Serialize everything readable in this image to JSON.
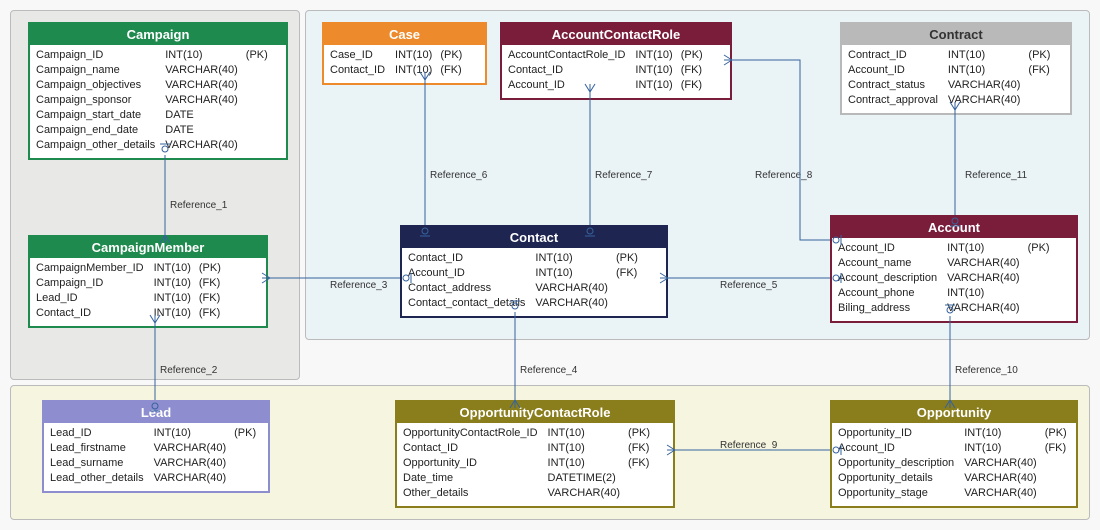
{
  "diagram_type": "ER diagram",
  "entities": {
    "campaign": {
      "title": "Campaign",
      "fields": [
        {
          "name": "Campaign_ID",
          "type": "INT(10)",
          "key": "(PK)"
        },
        {
          "name": "Campaign_name",
          "type": "VARCHAR(40)",
          "key": ""
        },
        {
          "name": "Campaign_objectives",
          "type": "VARCHAR(40)",
          "key": ""
        },
        {
          "name": "Campaign_sponsor",
          "type": "VARCHAR(40)",
          "key": ""
        },
        {
          "name": "Campaign_start_date",
          "type": "DATE",
          "key": ""
        },
        {
          "name": "Campaign_end_date",
          "type": "DATE",
          "key": ""
        },
        {
          "name": "Campaign_other_details",
          "type": "VARCHAR(40)",
          "key": ""
        }
      ]
    },
    "case": {
      "title": "Case",
      "fields": [
        {
          "name": "Case_ID",
          "type": "INT(10)",
          "key": "(PK)"
        },
        {
          "name": "Contact_ID",
          "type": "INT(10)",
          "key": "(FK)"
        }
      ]
    },
    "acr": {
      "title": "AccountContactRole",
      "fields": [
        {
          "name": "AccountContactRole_ID",
          "type": "INT(10)",
          "key": "(PK)"
        },
        {
          "name": "Contact_ID",
          "type": "INT(10)",
          "key": "(FK)"
        },
        {
          "name": "Account_ID",
          "type": "INT(10)",
          "key": "(FK)"
        }
      ]
    },
    "contract": {
      "title": "Contract",
      "fields": [
        {
          "name": "Contract_ID",
          "type": "INT(10)",
          "key": "(PK)"
        },
        {
          "name": "Account_ID",
          "type": "INT(10)",
          "key": "(FK)"
        },
        {
          "name": "Contract_status",
          "type": "VARCHAR(40)",
          "key": ""
        },
        {
          "name": "Contract_approval",
          "type": "VARCHAR(40)",
          "key": ""
        }
      ]
    },
    "campaignmember": {
      "title": "CampaignMember",
      "fields": [
        {
          "name": "CampaignMember_ID",
          "type": "INT(10)",
          "key": "(PK)"
        },
        {
          "name": "Campaign_ID",
          "type": "INT(10)",
          "key": "(FK)"
        },
        {
          "name": "Lead_ID",
          "type": "INT(10)",
          "key": "(FK)"
        },
        {
          "name": "Contact_ID",
          "type": "INT(10)",
          "key": "(FK)"
        }
      ]
    },
    "contact": {
      "title": "Contact",
      "fields": [
        {
          "name": "Contact_ID",
          "type": "INT(10)",
          "key": "(PK)"
        },
        {
          "name": "Account_ID",
          "type": "INT(10)",
          "key": "(FK)"
        },
        {
          "name": "Contact_address",
          "type": "VARCHAR(40)",
          "key": ""
        },
        {
          "name": "Contact_contact_details",
          "type": "VARCHAR(40)",
          "key": ""
        }
      ]
    },
    "account": {
      "title": "Account",
      "fields": [
        {
          "name": "Account_ID",
          "type": "INT(10)",
          "key": "(PK)"
        },
        {
          "name": "Account_name",
          "type": "VARCHAR(40)",
          "key": ""
        },
        {
          "name": "Account_description",
          "type": "VARCHAR(40)",
          "key": ""
        },
        {
          "name": "Account_phone",
          "type": "INT(10)",
          "key": ""
        },
        {
          "name": "Biling_address",
          "type": "VARCHAR(40)",
          "key": ""
        }
      ]
    },
    "lead": {
      "title": "Lead",
      "fields": [
        {
          "name": "Lead_ID",
          "type": "INT(10)",
          "key": "(PK)"
        },
        {
          "name": "Lead_firstname",
          "type": "VARCHAR(40)",
          "key": ""
        },
        {
          "name": "Lead_surname",
          "type": "VARCHAR(40)",
          "key": ""
        },
        {
          "name": "Lead_other_details",
          "type": "VARCHAR(40)",
          "key": ""
        }
      ]
    },
    "ocr": {
      "title": "OpportunityContactRole",
      "fields": [
        {
          "name": "OpportunityContactRole_ID",
          "type": "INT(10)",
          "key": "(PK)"
        },
        {
          "name": "Contact_ID",
          "type": "INT(10)",
          "key": "(FK)"
        },
        {
          "name": "Opportunity_ID",
          "type": "INT(10)",
          "key": "(FK)"
        },
        {
          "name": "Date_time",
          "type": "DATETIME(2)",
          "key": ""
        },
        {
          "name": "Other_details",
          "type": "VARCHAR(40)",
          "key": ""
        }
      ]
    },
    "opportunity": {
      "title": "Opportunity",
      "fields": [
        {
          "name": "Opportunity_ID",
          "type": "INT(10)",
          "key": "(PK)"
        },
        {
          "name": "Account_ID",
          "type": "INT(10)",
          "key": "(FK)"
        },
        {
          "name": "Opportunity_description",
          "type": "VARCHAR(40)",
          "key": ""
        },
        {
          "name": "Opportunity_details",
          "type": "VARCHAR(40)",
          "key": ""
        },
        {
          "name": "Opportunity_stage",
          "type": "VARCHAR(40)",
          "key": ""
        }
      ]
    }
  },
  "references": {
    "r1": "Reference_1",
    "r2": "Reference_2",
    "r3": "Reference_3",
    "r4": "Reference_4",
    "r5": "Reference_5",
    "r6": "Reference_6",
    "r7": "Reference_7",
    "r8": "Reference_8",
    "r9": "Reference_9",
    "r10": "Reference_10",
    "r11": "Reference_11"
  },
  "chart_data": {
    "type": "er-diagram",
    "entities": [
      "Campaign",
      "Case",
      "AccountContactRole",
      "Contract",
      "CampaignMember",
      "Contact",
      "Account",
      "Lead",
      "OpportunityContactRole",
      "Opportunity"
    ],
    "relationships": [
      {
        "name": "Reference_1",
        "from": "Campaign",
        "to": "CampaignMember"
      },
      {
        "name": "Reference_2",
        "from": "CampaignMember",
        "to": "Lead"
      },
      {
        "name": "Reference_3",
        "from": "CampaignMember",
        "to": "Contact"
      },
      {
        "name": "Reference_4",
        "from": "Contact",
        "to": "OpportunityContactRole"
      },
      {
        "name": "Reference_5",
        "from": "Contact",
        "to": "Account"
      },
      {
        "name": "Reference_6",
        "from": "Case",
        "to": "Contact"
      },
      {
        "name": "Reference_7",
        "from": "AccountContactRole",
        "to": "Contact"
      },
      {
        "name": "Reference_8",
        "from": "AccountContactRole",
        "to": "Account"
      },
      {
        "name": "Reference_9",
        "from": "OpportunityContactRole",
        "to": "Opportunity"
      },
      {
        "name": "Reference_10",
        "from": "Account",
        "to": "Opportunity"
      },
      {
        "name": "Reference_11",
        "from": "Contract",
        "to": "Account"
      }
    ]
  }
}
